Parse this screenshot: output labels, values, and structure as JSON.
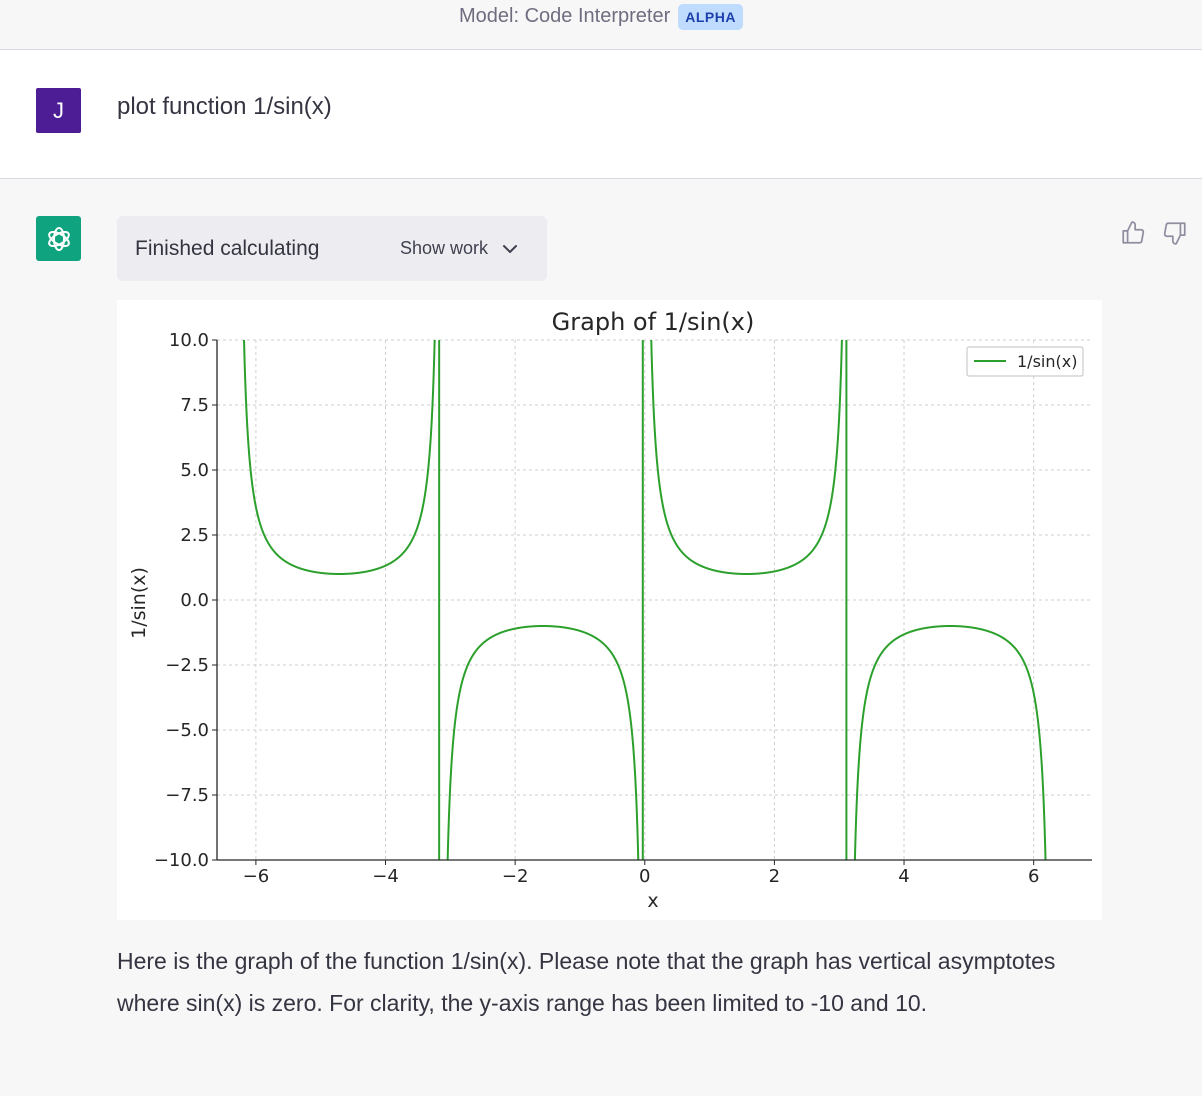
{
  "header": {
    "model_label": "Model: Code Interpreter",
    "badge": "ALPHA"
  },
  "user": {
    "avatar_letter": "J",
    "message": "plot function 1/sin(x)"
  },
  "assistant": {
    "status": "Finished calculating",
    "show_work_label": "Show work",
    "answer": "Here is the graph of the function 1/sin(x). Please note that the graph has vertical asymptotes where sin(x) is zero. For clarity, the y-axis range has been limited to -10 and 10."
  },
  "icons": {
    "avatar_bot": "openai-logo-icon",
    "thumbs_up": "thumbs-up-icon",
    "thumbs_down": "thumbs-down-icon",
    "chevron": "chevron-down-icon"
  },
  "colors": {
    "line": "#2ca02c",
    "bot_avatar": "#10a37f",
    "user_avatar": "#4c1d95",
    "badge_bg": "#bfdbfe"
  },
  "chart_data": {
    "type": "line",
    "title": "Graph of 1/sin(x)",
    "xlabel": "x",
    "ylabel": "1/sin(x)",
    "xlim": [
      -6.6,
      6.9
    ],
    "ylim": [
      -10,
      10
    ],
    "xticks": [
      -6,
      -4,
      -2,
      0,
      2,
      4,
      6
    ],
    "xtick_labels": [
      "−6",
      "−4",
      "−2",
      "0",
      "2",
      "4",
      "6"
    ],
    "yticks": [
      10,
      7.5,
      5,
      2.5,
      0,
      -2.5,
      -5,
      -7.5,
      -10
    ],
    "ytick_labels": [
      "10.0",
      "7.5",
      "5.0",
      "2.5",
      "0.0",
      "−2.5",
      "−5.0",
      "−7.5",
      "−10.0"
    ],
    "grid": true,
    "legend": "top-right",
    "series": [
      {
        "name": "1/sin(x)",
        "function": "1/sin(x)",
        "x_range": [
          -6.283,
          6.283
        ]
      }
    ]
  }
}
